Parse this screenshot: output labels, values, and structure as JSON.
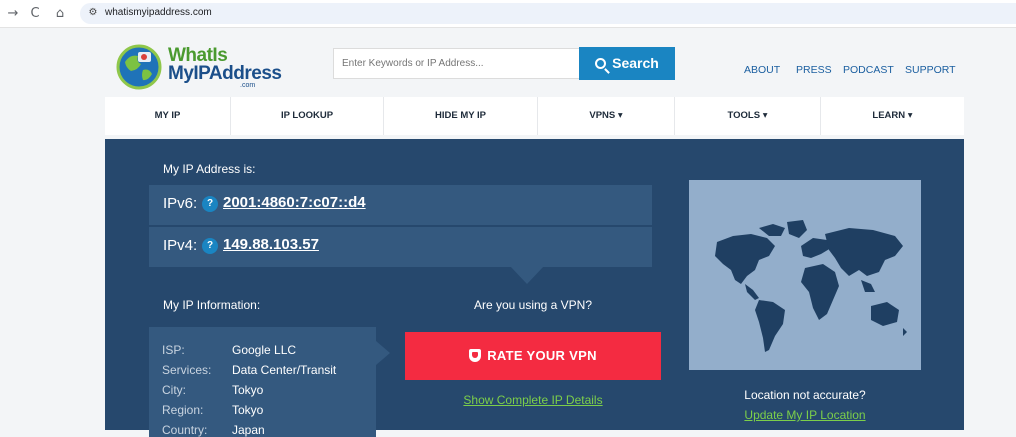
{
  "browser": {
    "url": "whatismyipaddress.com",
    "back_glyph": "→",
    "reload_glyph": "C",
    "home_glyph": "⌂",
    "site_info_glyph": "⚙"
  },
  "logo": {
    "line1": "WhatIs",
    "line2": "MyIPAddress",
    "line3": ".com"
  },
  "search": {
    "placeholder": "Enter Keywords or IP Address...",
    "button_label": "Search"
  },
  "topnav": [
    "ABOUT",
    "PRESS",
    "PODCAST",
    "SUPPORT"
  ],
  "mainnav": [
    "MY IP",
    "IP LOOKUP",
    "HIDE MY IP",
    "VPNS ▾",
    "TOOLS ▾",
    "LEARN ▾"
  ],
  "ip": {
    "heading": "My IP Address is:",
    "ipv6_label": "IPv6:",
    "ipv6": "2001:4860:7:c07::d4",
    "ipv4_label": "IPv4:",
    "ipv4": "149.88.103.57",
    "help_glyph": "?"
  },
  "info": {
    "heading": "My IP Information:",
    "rows": [
      {
        "key": "ISP:",
        "value": "Google LLC"
      },
      {
        "key": "Services:",
        "value": "Data Center/Transit"
      },
      {
        "key": "City:",
        "value": "Tokyo"
      },
      {
        "key": "Region:",
        "value": "Tokyo"
      },
      {
        "key": "Country:",
        "value": "Japan"
      }
    ]
  },
  "vpn": {
    "question": "Are you using a VPN?",
    "button_label": "RATE YOUR VPN",
    "details_link": "Show Complete IP Details"
  },
  "location": {
    "question": "Location not accurate?",
    "link": "Update My IP Location"
  },
  "colors": {
    "panel": "#26486d",
    "accent_blue": "#1a85c2",
    "vpn_red": "#f42b41",
    "link_green": "#7ccf4a"
  }
}
